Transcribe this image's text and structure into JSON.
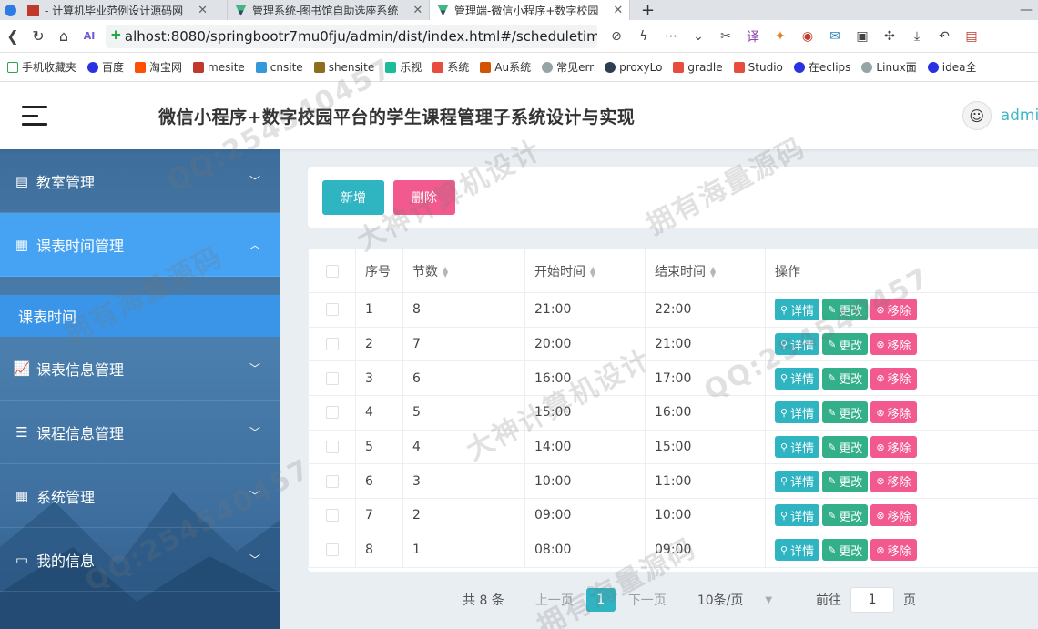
{
  "browser": {
    "tabs": [
      {
        "label": "- 计算机毕业范例设计源码网",
        "active": false
      },
      {
        "label": "管理系统-图书馆自助选座系统",
        "active": false
      },
      {
        "label": "管理端-微信小程序+数字校园",
        "active": true
      }
    ],
    "new_tab": "+",
    "url": "alhost:8080/springbootr7mu0fju/admin/dist/index.html#/scheduletime",
    "bookmarks": [
      "手机收藏夹",
      "百度",
      "淘宝网",
      "mesite",
      "cnsite",
      "shensite",
      "乐视",
      "系统",
      "Au系统",
      "常见err",
      "proxyLo",
      "gradle",
      "Studio",
      "在eclips",
      "Linux面",
      "idea全"
    ]
  },
  "header": {
    "title": "微信小程序+数字校园平台的学生课程管理子系统设计与实现",
    "username": "admin"
  },
  "sidebar": {
    "items": [
      {
        "label": "教室管理",
        "open": false
      },
      {
        "label": "课表时间管理",
        "open": true,
        "children": [
          "课表时间"
        ]
      },
      {
        "label": "课表信息管理",
        "open": false
      },
      {
        "label": "课程信息管理",
        "open": false
      },
      {
        "label": "系统管理",
        "open": false
      },
      {
        "label": "我的信息",
        "open": false
      }
    ]
  },
  "toolbar": {
    "add_label": "新增",
    "delete_label": "删除"
  },
  "table": {
    "headers": {
      "index": "序号",
      "period": "节数",
      "start": "开始时间",
      "end": "结束时间",
      "actions": "操作"
    },
    "rows": [
      {
        "index": "1",
        "period": "8",
        "start": "21:00",
        "end": "22:00"
      },
      {
        "index": "2",
        "period": "7",
        "start": "20:00",
        "end": "21:00"
      },
      {
        "index": "3",
        "period": "6",
        "start": "16:00",
        "end": "17:00"
      },
      {
        "index": "4",
        "period": "5",
        "start": "15:00",
        "end": "16:00"
      },
      {
        "index": "5",
        "period": "4",
        "start": "14:00",
        "end": "15:00"
      },
      {
        "index": "6",
        "period": "3",
        "start": "10:00",
        "end": "11:00"
      },
      {
        "index": "7",
        "period": "2",
        "start": "09:00",
        "end": "10:00"
      },
      {
        "index": "8",
        "period": "1",
        "start": "08:00",
        "end": "09:00"
      }
    ],
    "actions": {
      "detail": "详情",
      "edit": "更改",
      "remove": "移除"
    }
  },
  "pager": {
    "total": "共 8 条",
    "prev": "上一页",
    "current": "1",
    "next": "下一页",
    "page_size": "10条/页",
    "goto_prefix": "前往",
    "goto_value": "1",
    "goto_suffix": "页"
  },
  "watermarks": [
    "QQ:254540457",
    "大神计算机设计",
    "拥有海量源码"
  ],
  "colors": {
    "accent": "#2fb4c2",
    "danger": "#f25a8f",
    "edit": "#33b089",
    "sidebar_active": "#46a2f2"
  }
}
